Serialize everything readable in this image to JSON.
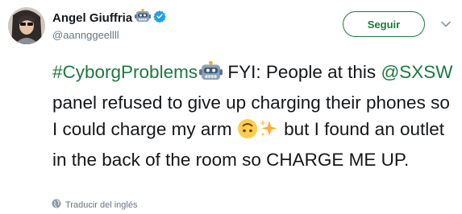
{
  "author": {
    "display_name": "Angel Giuffria",
    "handle": "@aannggeellll",
    "verified": true,
    "name_emoji": "robot-face-icon"
  },
  "actions": {
    "follow_label": "Seguir",
    "menu_icon": "chevron-down-icon"
  },
  "tweet": {
    "hashtag": "#CyborgProblems",
    "after_hashtag": " FYI: People at this ",
    "mention": "@SXSW",
    "after_mention": " panel refused to give up charging their phones so I could charge my arm ",
    "after_emojis": " but I found an outlet in the back of the room so CHARGE ME UP.",
    "emojis": [
      "robot-face-icon",
      "upside-down-face-icon",
      "sparkles-icon"
    ]
  },
  "footer": {
    "translate_label": "Traducir del inglés",
    "translate_icon": "globe-icon"
  },
  "colors": {
    "accent": "#1b7a3e",
    "text": "#14171a",
    "muted": "#657786",
    "verified": "#1da1f2"
  }
}
